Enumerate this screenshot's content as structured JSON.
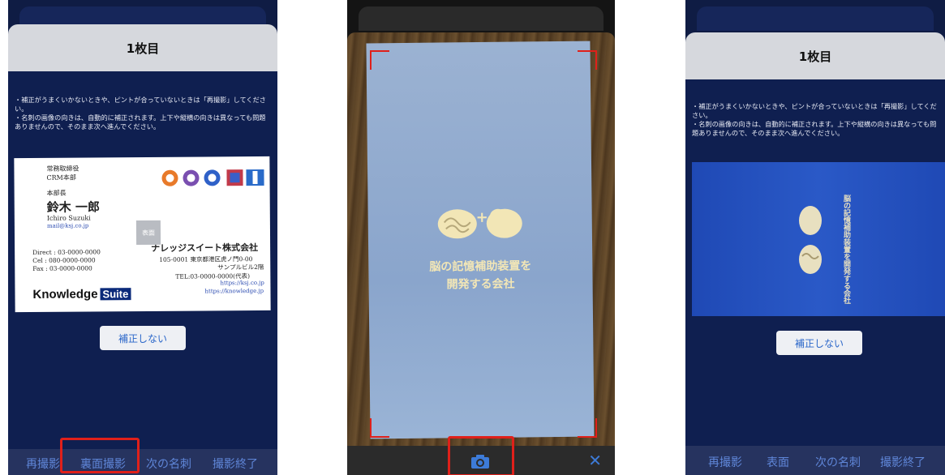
{
  "panel1": {
    "title": "1枚目",
    "instructions": "・補正がうまくいかないときや、ピントが合っていないときは「再撮影」してください。\n・名刺の画像の向きは、自動的に補正されます。上下や縦横の向きは異なっても問題ありませんので、そのまま次へ進んでください。",
    "card": {
      "position": "常務取締役",
      "dept": "CRM本部",
      "role": "本部長",
      "name": "鈴木 一郎",
      "name_roman": "Ichiro Suzuki",
      "email": "mail@ksj.co.jp",
      "direct": "Direct : 03-0000-0000",
      "cel": "Cel    : 080-0000-0000",
      "fax": "Fax    : 03-0000-0000",
      "company": "ナレッジスイート株式会社",
      "address": "105-0001 東京都港区虎ノ門0-00",
      "building": "サンプルビル2階",
      "tel": "TEL:03-0000-0000(代表)",
      "url1": "https://ksj.co.jp",
      "url2": "https://knowledge.jp",
      "logo_left": "Knowledge",
      "logo_right": "Suite",
      "side_badge": "表面"
    },
    "no_correction": "補正しない",
    "bottom": [
      "再撮影",
      "裏面撮影",
      "次の名刺",
      "撮影終了"
    ]
  },
  "panel2": {
    "card_text_line1": "脳の記憶補助装置を",
    "card_text_line2": "開発する会社",
    "plus": "+",
    "close": "✕",
    "camera_icon": "camera-icon"
  },
  "panel3": {
    "title": "1枚目",
    "instructions": "・補正がうまくいかないときや、ピントが合っていないときは「再撮影」してください。\n・名刺の画像の向きは、自動的に補正されます。上下や縦横の向きは異なっても問題ありませんので、そのまま次へ進んでください。",
    "card_text": "脳の記憶補助装置を開発する会社",
    "no_correction": "補正しない",
    "bottom": [
      "再撮影",
      "表面",
      "次の名刺",
      "撮影終了"
    ]
  },
  "colors": {
    "accent": "#e0201a",
    "navy": "#0f1f50",
    "link": "#5f86d8"
  }
}
